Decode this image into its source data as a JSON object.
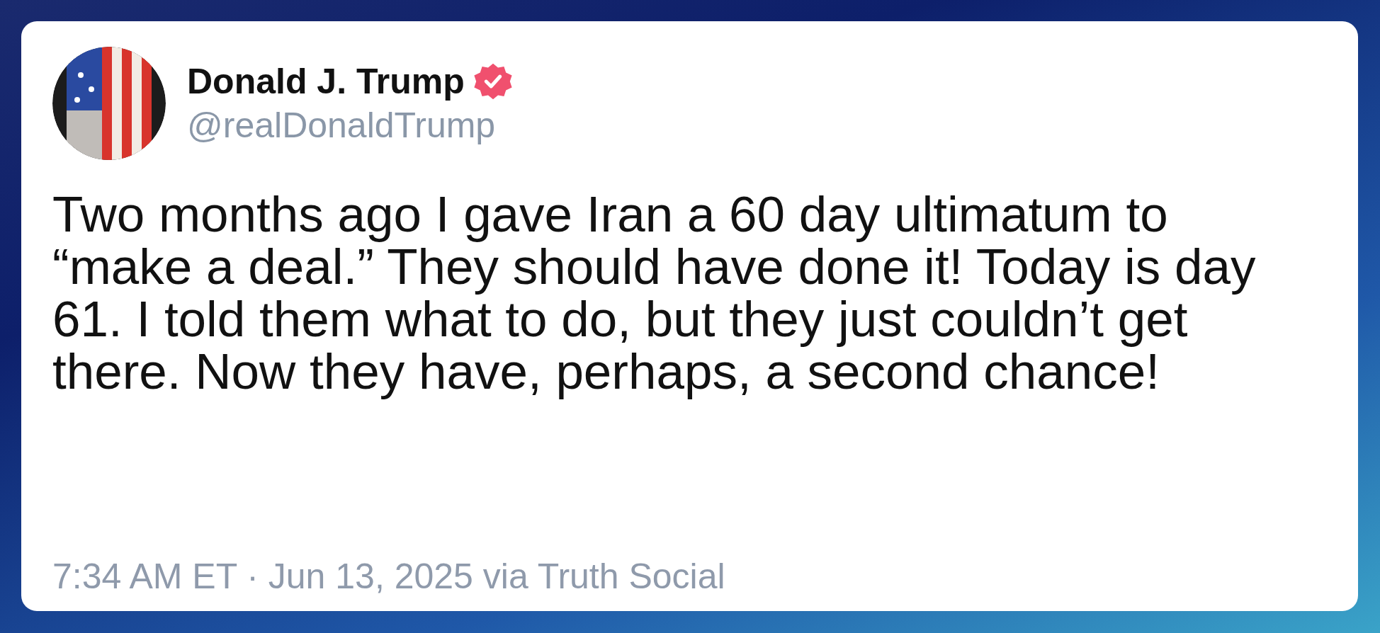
{
  "post": {
    "author": {
      "name": "Donald J. Trump",
      "verified": true,
      "handle": "@realDonaldTrump"
    },
    "text": "Two months ago I gave Iran a 60 day ultimatum to “make a deal.” They should have done it! Today is day 61. I told them what to do, but they just couldn’t get there. Now they have, perhaps, a second chance!",
    "footer": "7:34 AM ET · Jun 13, 2025 via Truth Social"
  }
}
